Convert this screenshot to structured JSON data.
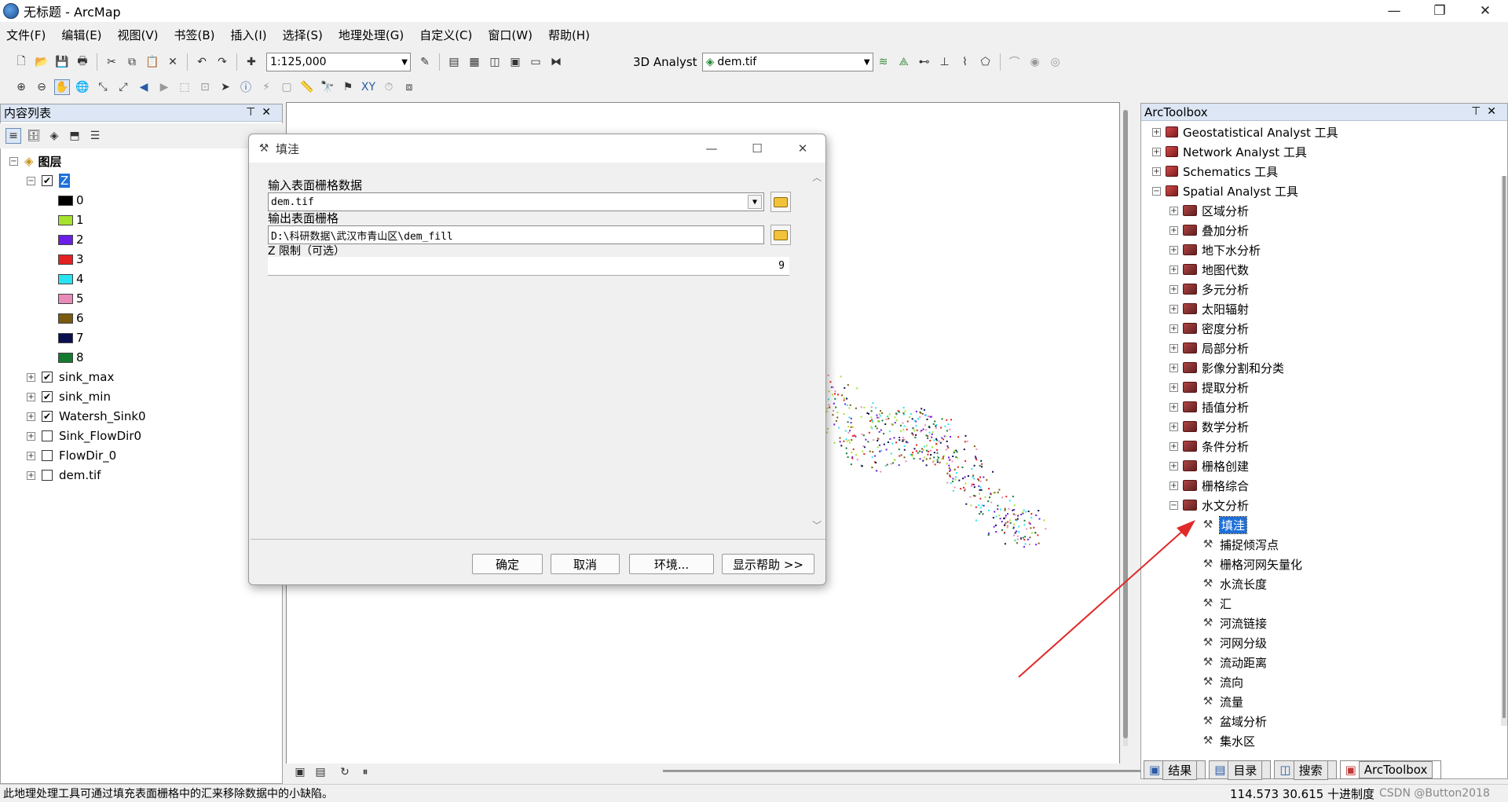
{
  "window": {
    "title": "无标题 - ArcMap",
    "minimize": "—",
    "maximize": "❐",
    "close": "✕"
  },
  "menu": [
    "文件(F)",
    "编辑(E)",
    "视图(V)",
    "书签(B)",
    "插入(I)",
    "选择(S)",
    "地理处理(G)",
    "自定义(C)",
    "窗口(W)",
    "帮助(H)"
  ],
  "toolbar": {
    "scale": "1:125,000",
    "analyst": "3D Analyst",
    "layer_combo": "dem.tif"
  },
  "toc": {
    "title": "内容列表",
    "root": "图层",
    "group": "Z",
    "legend": [
      {
        "label": "0",
        "color": "#000000"
      },
      {
        "label": "1",
        "color": "#a6e22e"
      },
      {
        "label": "2",
        "color": "#6a1ee8"
      },
      {
        "label": "3",
        "color": "#e52020"
      },
      {
        "label": "4",
        "color": "#29e3f0"
      },
      {
        "label": "5",
        "color": "#e88bb8"
      },
      {
        "label": "6",
        "color": "#7a5a10"
      },
      {
        "label": "7",
        "color": "#0a1050"
      },
      {
        "label": "8",
        "color": "#137a30"
      }
    ],
    "layers": [
      {
        "name": "sink_max",
        "checked": true
      },
      {
        "name": "sink_min",
        "checked": true
      },
      {
        "name": "Watersh_Sink0",
        "checked": true
      },
      {
        "name": "Sink_FlowDir0",
        "checked": false
      },
      {
        "name": "FlowDir_0",
        "checked": false
      },
      {
        "name": "dem.tif",
        "checked": false
      }
    ]
  },
  "arctoolbox": {
    "title": "ArcToolbox",
    "top": [
      "Geostatistical Analyst 工具",
      "Network Analyst 工具",
      "Schematics 工具",
      "Spatial Analyst 工具"
    ],
    "spatial": [
      "区域分析",
      "叠加分析",
      "地下水分析",
      "地图代数",
      "多元分析",
      "太阳辐射",
      "密度分析",
      "局部分析",
      "影像分割和分类",
      "提取分析",
      "插值分析",
      "数学分析",
      "条件分析",
      "栅格创建",
      "栅格综合",
      "水文分析"
    ],
    "hydro_tools": [
      "填洼",
      "捕捉倾泻点",
      "栅格河网矢量化",
      "水流长度",
      "汇",
      "河流链接",
      "河网分级",
      "流动距离",
      "流向",
      "流量",
      "盆域分析",
      "集水区"
    ],
    "tabs": [
      "结果",
      "目录",
      "搜索",
      "ArcToolbox"
    ]
  },
  "dialog": {
    "title": "填洼",
    "input_label": "输入表面栅格数据",
    "input_value": "dem.tif",
    "output_label": "输出表面栅格",
    "output_value": "D:\\科研数据\\武汉市青山区\\dem_fill",
    "z_label": "Z 限制（可选）",
    "z_value": "9",
    "buttons": [
      "确定",
      "取消",
      "环境...",
      "显示帮助 >>"
    ]
  },
  "status": {
    "message": "此地理处理工具可通过填充表面栅格中的汇来移除数据中的小缺陷。",
    "coords": "114.573  30.615 十进制度",
    "watermark": "CSDN @Button2018"
  }
}
